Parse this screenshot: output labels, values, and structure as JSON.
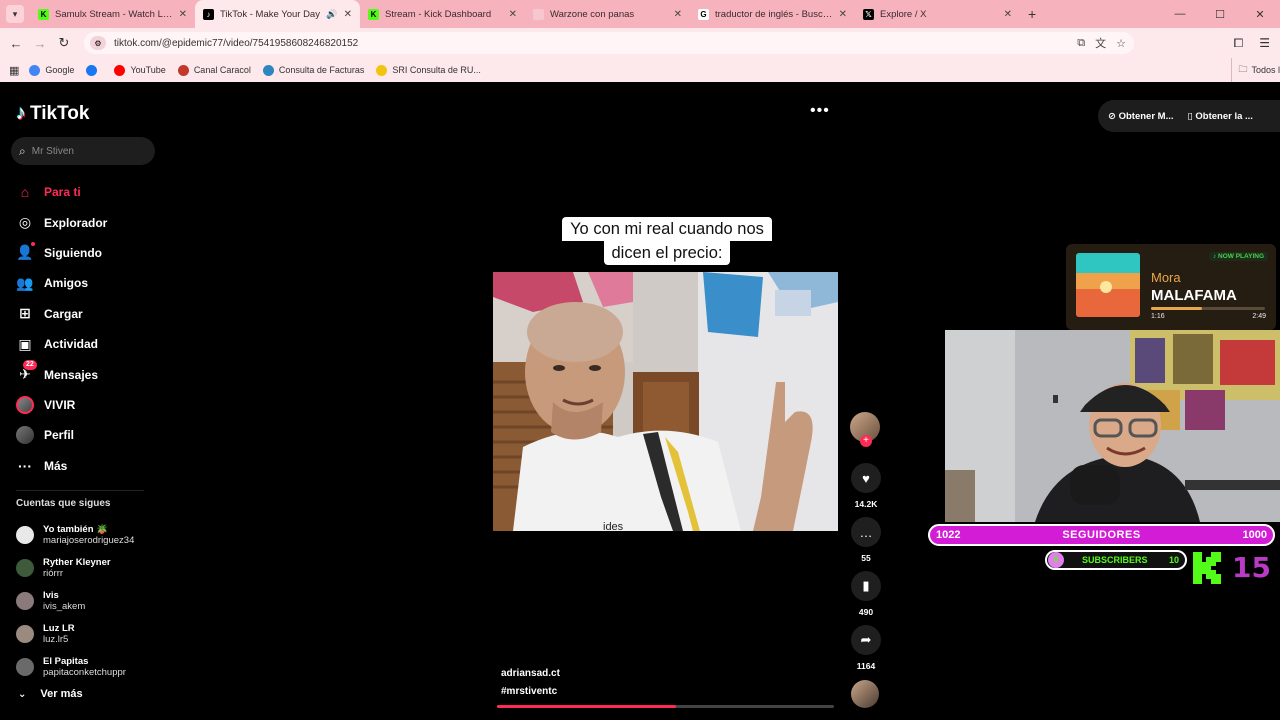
{
  "browser": {
    "tabs": [
      {
        "title": "Samulx Stream - Watch Live on",
        "favicon": "kick-icon",
        "color": "#53fc18",
        "active": false
      },
      {
        "title": "TikTok - Make Your Day",
        "favicon": "tiktok-icon",
        "color": "#000000",
        "active": true,
        "audio": true
      },
      {
        "title": "Stream - Kick Dashboard",
        "favicon": "kick-icon",
        "color": "#53fc18",
        "active": false
      },
      {
        "title": "Warzone con panas",
        "favicon": "circle-icon",
        "color": "#f7c6cf",
        "active": false
      },
      {
        "title": "traductor de inglés - Buscar co",
        "favicon": "google-icon",
        "color": "#ffffff",
        "active": false
      },
      {
        "title": "Explore / X",
        "favicon": "x-icon",
        "color": "#000000",
        "active": false
      }
    ],
    "url": "tiktok.com/@epidemic77/video/7541958608246820152",
    "bookmarks": [
      {
        "label": "Google",
        "color": "#4285f4"
      },
      {
        "label": "",
        "color": "#1877f2"
      },
      {
        "label": "YouTube",
        "color": "#ff0000"
      },
      {
        "label": "Canal Caracol",
        "color": "#c0392b"
      },
      {
        "label": "Consulta de Facturas",
        "color": "#2e86c1"
      },
      {
        "label": "SRI Consulta de RU...",
        "color": "#f1c40f"
      }
    ],
    "bookmarks_right": "Todos l"
  },
  "tiktok": {
    "logo": "TikTok",
    "search_placeholder": "Mr Stiven",
    "nav": [
      {
        "label": "Para ti",
        "icon": "home-icon",
        "active": true
      },
      {
        "label": "Explorador",
        "icon": "compass-icon"
      },
      {
        "label": "Siguiendo",
        "icon": "following-icon",
        "dot": true
      },
      {
        "label": "Amigos",
        "icon": "friends-icon"
      },
      {
        "label": "Cargar",
        "icon": "upload-icon"
      },
      {
        "label": "Actividad",
        "icon": "activity-icon"
      },
      {
        "label": "Mensajes",
        "icon": "messages-icon",
        "badge": "22"
      },
      {
        "label": "VIVIR",
        "icon": "live-avatar"
      },
      {
        "label": "Perfil",
        "icon": "profile-avatar"
      },
      {
        "label": "Más",
        "icon": "more-icon"
      }
    ],
    "following_title": "Cuentas que sigues",
    "following": [
      {
        "name": "Yo también 🪴",
        "handle": "mariajoserodriguez34",
        "color": "#e8e8e8"
      },
      {
        "name": "Ryther Kleyner",
        "handle": "riórrr",
        "color": "#3d5a3a"
      },
      {
        "name": "Ivis",
        "handle": "ivis_akem",
        "color": "#8a7a7a"
      },
      {
        "name": "Luz LR",
        "handle": "luz.lr5",
        "color": "#9a8a80"
      },
      {
        "name": "El Papitas",
        "handle": "papitaconketchuppr",
        "color": "#6a6a6a"
      }
    ],
    "see_more": "Ver más",
    "top_actions": [
      "Obtener M...",
      "Obtener la ..."
    ],
    "video": {
      "caption_line1": "Yo con mi real cuando nos",
      "caption_line2": "dicen el precio:",
      "shirt_text": "ides",
      "username": "adriansad.ct",
      "hashtag": "#mrstiventc",
      "progress": 0.53
    },
    "counts": {
      "likes": "14.2K",
      "comments": "55",
      "saves": "490",
      "shares": "1164"
    }
  },
  "stream": {
    "now_playing": {
      "tag": "♪ NOW PLAYING",
      "artist": "Mora",
      "song": "MALAFAMA",
      "elapsed": "1:16",
      "duration": "2:49",
      "progress": 0.45
    },
    "followers_goal": {
      "left": "1022",
      "label": "SEGUIDORES",
      "right": "1000"
    },
    "subscribers": {
      "current": "0",
      "label": "SUBSCRIBERS",
      "goal": "10"
    },
    "kick_number": "15"
  }
}
